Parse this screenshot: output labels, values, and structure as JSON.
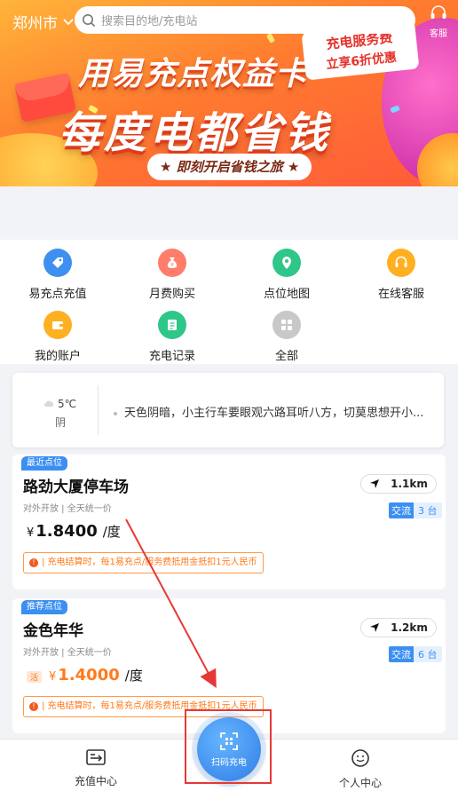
{
  "header": {
    "city": "郑州市",
    "search_placeholder": "搜索目的地/充电站",
    "service_label": "客服"
  },
  "banner": {
    "title": "用易充点权益卡",
    "tag_line1": "充电服务费",
    "tag_line2": "立享6折优惠",
    "main": "每度电都省钱",
    "sub": "★ 即刻开启省钱之旅 ★"
  },
  "menu": [
    {
      "label": "易充点充值",
      "icon": "tag-icon",
      "color": "#3f8ff0"
    },
    {
      "label": "月费购买",
      "icon": "money-bag-icon",
      "color": "#ff7d6b"
    },
    {
      "label": "点位地图",
      "icon": "map-pin-icon",
      "color": "#2fc68a"
    },
    {
      "label": "在线客服",
      "icon": "headset-icon",
      "color": "#ffb020"
    },
    {
      "label": "我的账户",
      "icon": "wallet-icon",
      "color": "#ffb020"
    },
    {
      "label": "充电记录",
      "icon": "record-icon",
      "color": "#2fc68a"
    },
    {
      "label": "全部",
      "icon": "grid-icon",
      "color": "#c8c8c8"
    }
  ],
  "weather": {
    "temp": "5℃",
    "condition": "阴",
    "tip": "天色阴暗，小主行车要眼观六路耳听八方，切莫思想开小..."
  },
  "stations": [
    {
      "tag": "最近点位",
      "name": "路劲大厦停车场",
      "distance": "1.1km",
      "meta": "对外开放 | 全天统一价",
      "badge_type": "交流",
      "badge_count": "3 台",
      "currency": "¥",
      "price": "1.8400",
      "unit": "/度",
      "note": "| 充电结算时，每1易充点/服务费抵用金抵扣1元人民币"
    },
    {
      "tag": "推荐点位",
      "name": "金色年华",
      "distance": "1.2km",
      "meta": "对外开放 | 全天统一价",
      "sale": "活",
      "badge_type": "交流",
      "badge_count": "6 台",
      "currency": "¥",
      "price": "1.4000",
      "unit": "/度",
      "note": "| 充电结算时，每1易充点/服务费抵用金抵扣1元人民币"
    }
  ],
  "tabbar": {
    "recharge": "充值中心",
    "scan": "扫码充电",
    "profile": "个人中心"
  },
  "colors": {
    "accent": "#3b8ff2",
    "price_orange": "#ff7a1a",
    "annotation": "#e53935"
  }
}
